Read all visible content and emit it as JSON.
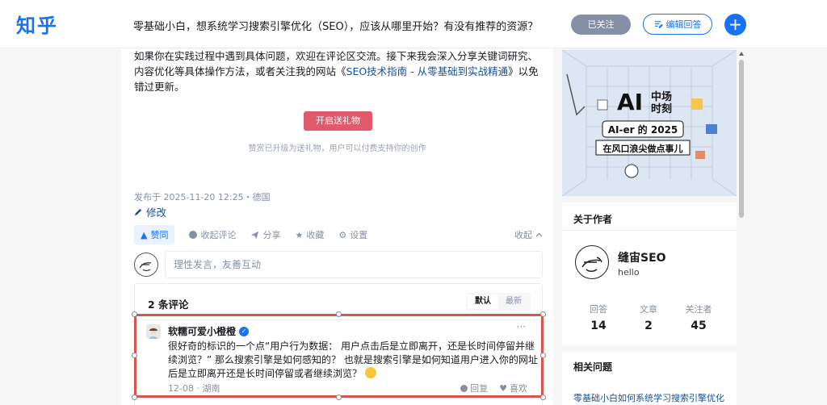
{
  "header": {
    "logo": "知乎",
    "question_title": "零基础小白，想系统学习搜索引擎优化（SEO），应该从哪里开始？有没有推荐的资源？",
    "followed_label": "已关注",
    "edit_answer_label": "编辑回答",
    "add_label": "+"
  },
  "answer": {
    "paragraph_prefix": "如果你在实践过程中遇到具体问题，欢迎在评论区交流。接下来我会深入分享关键词研究、内容优化等具体操作方法，或者关注我的网站《",
    "paragraph_link": "SEO技术指南 - 从零基础到实战精通",
    "paragraph_suffix": "》以免错过更新。",
    "gift_button": "开启送礼物",
    "gift_note": "赞赏已升级为送礼物，用户可以付费支持你的创作",
    "published": "发布于 2025-11-20 12:25・德国",
    "edit_label": "修改"
  },
  "actions": {
    "vote": "赞同",
    "collapse_comments": "收起评论",
    "share": "分享",
    "favorite": "收藏",
    "settings": "设置",
    "collapse": "收起"
  },
  "comment_input": {
    "placeholder": "理性发言，友善互动"
  },
  "comments": {
    "count_label": "2 条评论",
    "sort_default": "默认",
    "sort_latest": "最新",
    "items": [
      {
        "author": "软糯可爱小橙橙",
        "text": "很好奇的标识的一个点“用户行为数据： 用户点击后是立即离开，还是长时间停留并继续浏览？” 那么搜索引擎是如何感知的？ 也就是搜索引擎是如何知道用户进入你的网址后是立即离开还是长时间停留或者继续浏览？",
        "date": "12-08",
        "location": "湖南",
        "reply": "回复",
        "like": "喜欢",
        "more": "···"
      }
    ]
  },
  "banner": {
    "title_line1": "AI",
    "title_line2a": "中场",
    "title_line2b": "时刻",
    "subtitle1": "AI-er 的 2025",
    "subtitle2": "在风口浪尖做点事儿"
  },
  "author_card": {
    "heading": "关于作者",
    "name": "缝宙SEO",
    "bio": "hello",
    "stats": [
      {
        "label": "回答",
        "value": "14"
      },
      {
        "label": "文章",
        "value": "2"
      },
      {
        "label": "关注者",
        "value": "45"
      }
    ]
  },
  "related": {
    "heading": "相关问题",
    "first": "零基础小白如何系统学习搜索引擎优化"
  },
  "colors": {
    "brand": "#1772f6",
    "highlight": "#d9534f",
    "gift": "#e05a6b"
  }
}
